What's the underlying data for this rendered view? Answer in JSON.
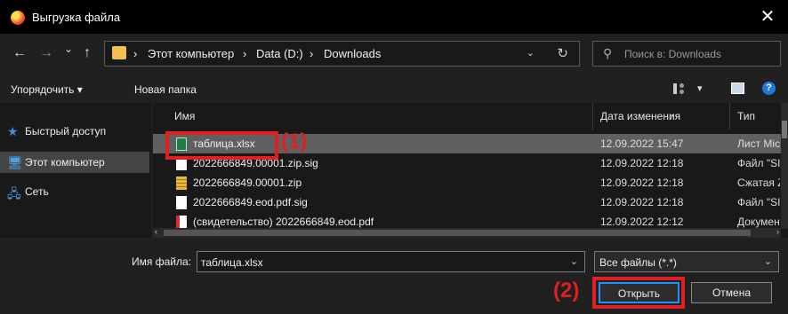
{
  "window": {
    "title": "Выгрузка файла",
    "close_glyph": "✕",
    "app_icon": "firefox-icon"
  },
  "nav": {
    "back": "←",
    "forward": "→",
    "recent": "⌄",
    "up": "↑"
  },
  "address": {
    "crumbs": [
      "Этот компьютер",
      "Data (D:)",
      "Downloads"
    ],
    "separator": "›",
    "separator_first": "›",
    "dropdown": "⌄",
    "refresh": "↻"
  },
  "search": {
    "placeholder": "Поиск в: Downloads"
  },
  "toolbar": {
    "organize": "Упорядочить ▾",
    "new_folder": "Новая папка",
    "view_dd": "▾",
    "help": "?"
  },
  "sidebar": {
    "items": [
      {
        "label": "Быстрый доступ",
        "icon": "★",
        "icon_name": "star-icon",
        "color": "#3b8ddd"
      },
      {
        "label": "Этот компьютер",
        "icon": "🖥",
        "icon_name": "computer-icon",
        "color": "#4aa3e8",
        "selected": true
      },
      {
        "label": "Сеть",
        "icon": "🖧",
        "icon_name": "network-icon",
        "color": "#4aa3e8"
      }
    ]
  },
  "columns": {
    "name": "Имя",
    "date": "Дата изменения",
    "type": "Тип"
  },
  "files": [
    {
      "name": "таблица.xlsx",
      "date": "12.09.2022 15:47",
      "type": "Лист Microsoft Excel",
      "icon": "xlsx",
      "selected": true
    },
    {
      "name": "2022666849.00001.zip.sig",
      "date": "12.09.2022 12:18",
      "type": "Файл \"SIG\"",
      "icon": "doc"
    },
    {
      "name": "2022666849.00001.zip",
      "date": "12.09.2022 12:18",
      "type": "Сжатая ZIP-папка",
      "icon": "zip"
    },
    {
      "name": "2022666849.eod.pdf.sig",
      "date": "12.09.2022 12:18",
      "type": "Файл \"SIG\"",
      "icon": "doc"
    },
    {
      "name": "(свидетельство) 2022666849.eod.pdf",
      "date": "12.09.2022 12:12",
      "type": "Документ Adobe",
      "icon": "pdf"
    }
  ],
  "bottom": {
    "filename_label": "Имя файла:",
    "filename_value": "таблица.xlsx",
    "filter_value": "Все файлы (*.*)",
    "open_label": "Открыть",
    "cancel_label": "Отмена"
  },
  "annotations": {
    "step1": "(1)",
    "step2": "(2)",
    "color": "#e02020"
  }
}
